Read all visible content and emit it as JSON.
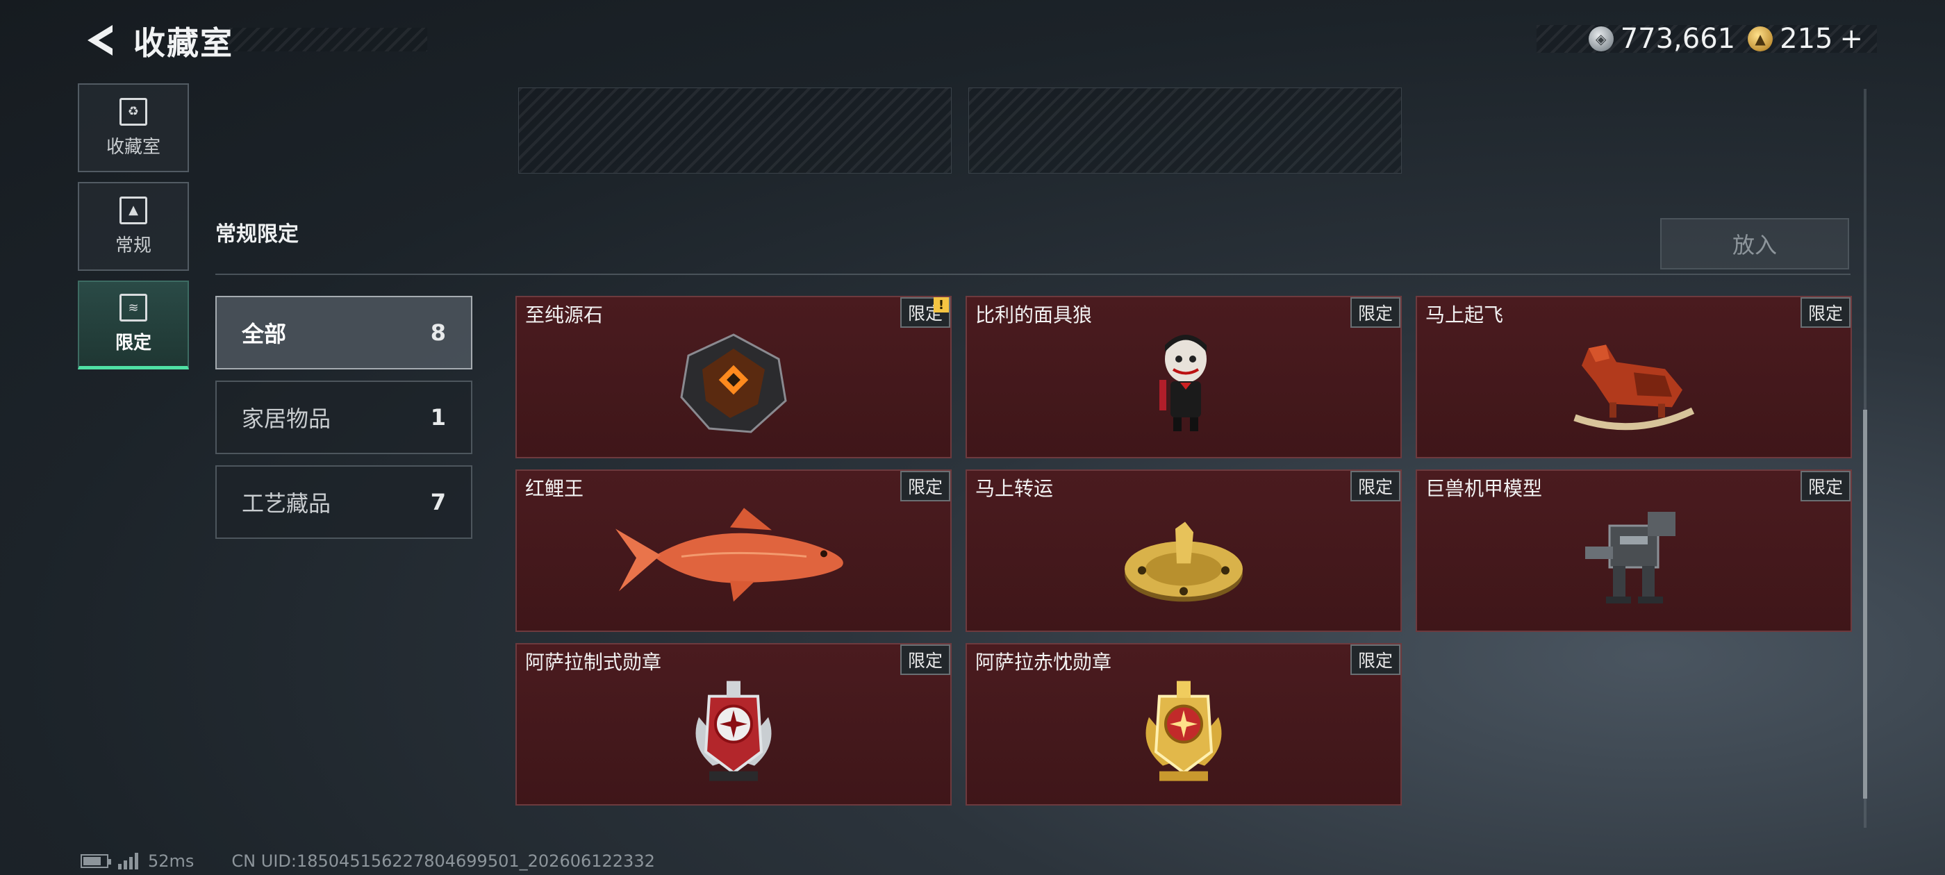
{
  "header": {
    "title": "收藏室",
    "currency_silver": "773,661",
    "currency_gold": "215",
    "gold_add": "+"
  },
  "nav": [
    {
      "label": "收藏室",
      "icon": "collection-room-icon"
    },
    {
      "label": "常规",
      "icon": "regular-icon"
    },
    {
      "label": "限定",
      "icon": "limited-icon",
      "active": true
    }
  ],
  "section": {
    "title": "常规限定",
    "put_button": "放入"
  },
  "categories": [
    {
      "label": "全部",
      "count": "8",
      "active": true
    },
    {
      "label": "家居物品",
      "count": "1"
    },
    {
      "label": "工艺藏品",
      "count": "7"
    }
  ],
  "items": [
    {
      "name": "至纯源石",
      "tag": "限定",
      "warn": "!",
      "icon": "crystal-stone-icon"
    },
    {
      "name": "比利的面具狼",
      "tag": "限定",
      "icon": "puppet-figure-icon"
    },
    {
      "name": "马上起飞",
      "tag": "限定",
      "icon": "rocking-horse-icon"
    },
    {
      "name": "红鲤王",
      "tag": "限定",
      "icon": "red-carp-icon"
    },
    {
      "name": "马上转运",
      "tag": "限定",
      "icon": "horse-dial-icon"
    },
    {
      "name": "巨兽机甲模型",
      "tag": "限定",
      "icon": "mech-model-icon"
    },
    {
      "name": "阿萨拉制式勋章",
      "tag": "限定",
      "icon": "silver-medal-icon"
    },
    {
      "name": "阿萨拉赤忱勋章",
      "tag": "限定",
      "icon": "gold-medal-icon"
    }
  ],
  "status_bar": {
    "ping": "52ms",
    "uid": "CN UID:185045156227804699501_202606122332"
  },
  "colors": {
    "accent": "#4fe0a4",
    "card_bg": "#4a1b1f",
    "tag_bg": "#22272b"
  }
}
